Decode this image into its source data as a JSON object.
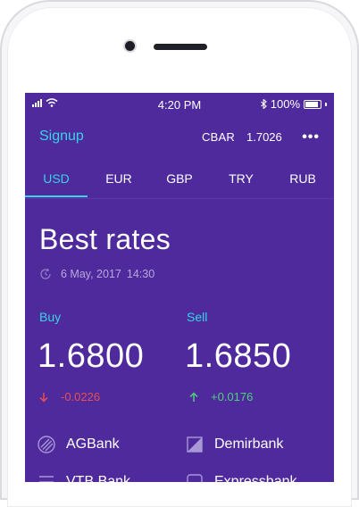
{
  "status": {
    "time": "4:20 PM",
    "battery": "100%"
  },
  "header": {
    "signup_label": "Signup",
    "cbar_label": "CBAR",
    "cbar_value": "1.7026",
    "more_icon": "more-dots-icon"
  },
  "tabs": [
    {
      "label": "USD",
      "active": true
    },
    {
      "label": "EUR",
      "active": false
    },
    {
      "label": "GBP",
      "active": false
    },
    {
      "label": "TRY",
      "active": false
    },
    {
      "label": "RUB",
      "active": false
    }
  ],
  "main": {
    "title": "Best rates",
    "date": "6 May, 2017",
    "time": "14:30",
    "buy": {
      "label": "Buy",
      "rate": "1.6800",
      "delta": "-0.0226",
      "direction": "down"
    },
    "sell": {
      "label": "Sell",
      "rate": "1.6850",
      "delta": "+0.0176",
      "direction": "up"
    }
  },
  "banks": [
    {
      "name": "AGBank"
    },
    {
      "name": "Demirbank"
    },
    {
      "name": "VTB Bank"
    },
    {
      "name": "Expressbank"
    }
  ],
  "colors": {
    "background": "#4f2a9d",
    "accent": "#38d3e6",
    "down": "#e65055",
    "up": "#4fd07e"
  }
}
